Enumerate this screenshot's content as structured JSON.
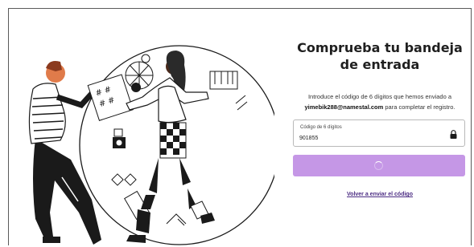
{
  "main": {
    "title": "Comprueba tu bandeja de entrada",
    "description_prefix": "Introduce el código de 6 dígitos que hemos enviado a",
    "email": "yimebik288@namestal.com",
    "description_suffix": "para completar el registro.",
    "code_field": {
      "label": "Código de 6 dígitos",
      "value": "901855"
    },
    "resend_link": "Volver a enviar el código"
  },
  "colors": {
    "button_bg": "#c597e6",
    "link": "#4b2c83"
  },
  "icons": {
    "field": "lock-icon",
    "button": "loading-spinner-icon"
  }
}
